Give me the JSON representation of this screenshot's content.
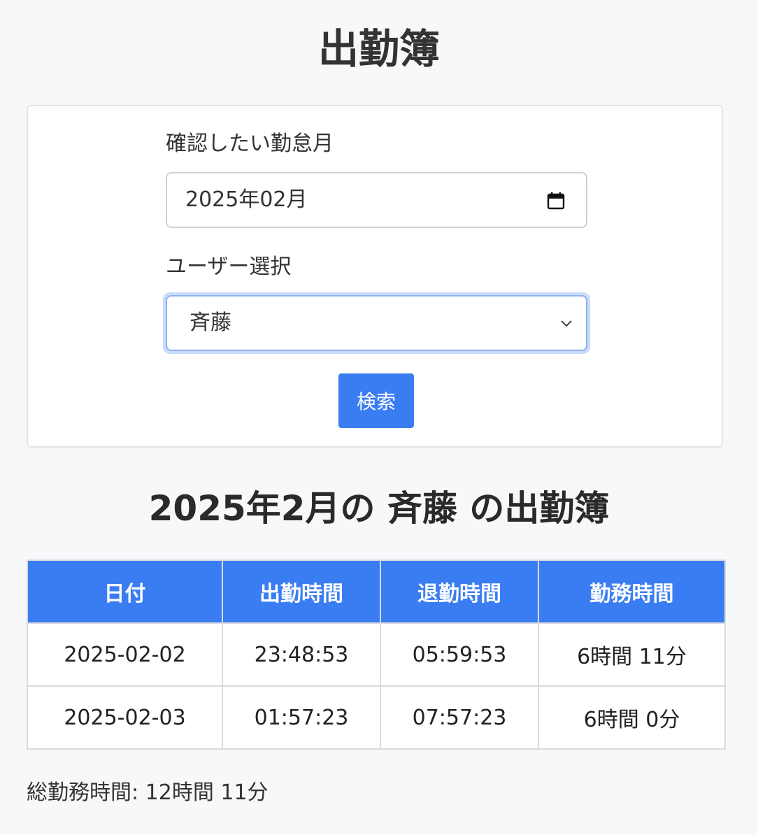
{
  "page_title": "出勤簿",
  "form": {
    "month_label": "確認したい勤怠月",
    "month_value": "2025年02月",
    "user_label": "ユーザー選択",
    "user_value": "斉藤",
    "search_label": "検索"
  },
  "result": {
    "title": "2025年2月の 斉藤 の出勤簿",
    "headers": [
      "日付",
      "出勤時間",
      "退勤時間",
      "勤務時間"
    ],
    "rows": [
      [
        "2025-02-02",
        "23:48:53",
        "05:59:53",
        "6時間 11分"
      ],
      [
        "2025-02-03",
        "01:57:23",
        "07:57:23",
        "6時間 0分"
      ]
    ],
    "total": "総勤務時間: 12時間 11分"
  },
  "icons": {
    "calendar": "calendar-icon",
    "dropdown": "chevron-down-icon"
  },
  "colors": {
    "accent": "#3a7df3",
    "background": "#f7f8fa"
  }
}
